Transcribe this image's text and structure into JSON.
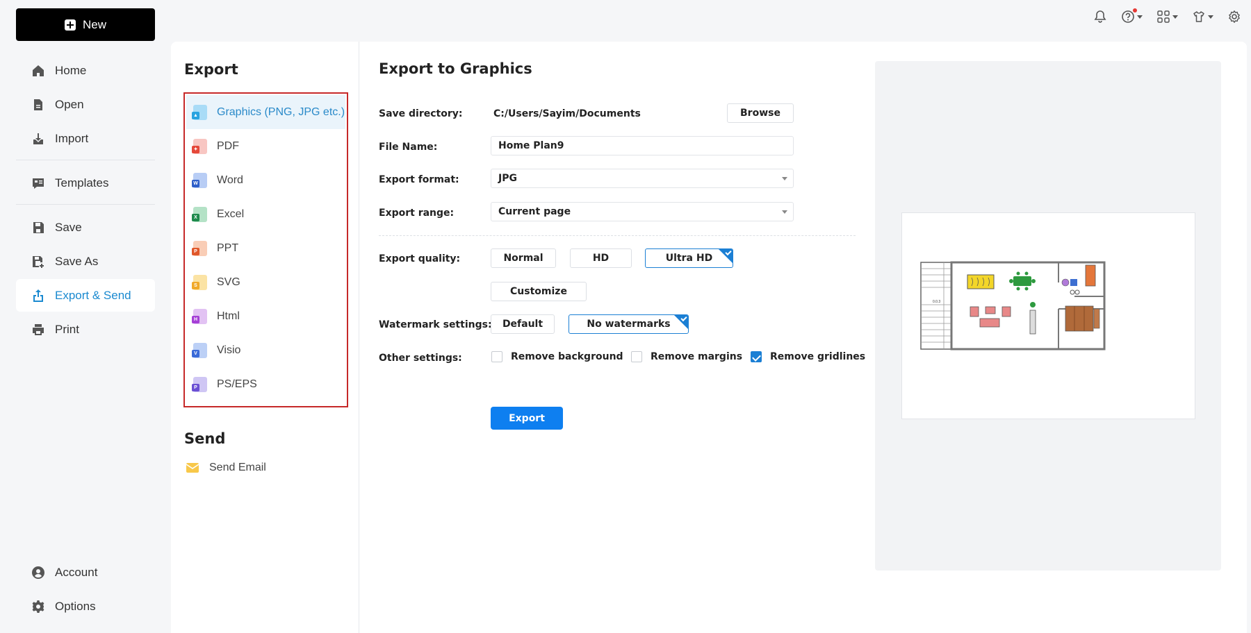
{
  "app": {
    "new_label": "New"
  },
  "topbar": {
    "icons": [
      "bell-icon",
      "help-icon",
      "apps-icon",
      "theme-icon",
      "settings-icon"
    ]
  },
  "nav": {
    "items": [
      {
        "label": "Home",
        "icon": "home-icon"
      },
      {
        "label": "Open",
        "icon": "open-icon"
      },
      {
        "label": "Import",
        "icon": "import-icon"
      },
      {
        "label": "Templates",
        "icon": "templates-icon"
      },
      {
        "label": "Save",
        "icon": "save-icon"
      },
      {
        "label": "Save As",
        "icon": "save-as-icon"
      },
      {
        "label": "Export & Send",
        "icon": "export-icon",
        "active": true
      },
      {
        "label": "Print",
        "icon": "print-icon"
      }
    ],
    "bottom": [
      {
        "label": "Account",
        "icon": "account-icon"
      },
      {
        "label": "Options",
        "icon": "options-icon"
      }
    ]
  },
  "export_section": {
    "title": "Export",
    "items": [
      {
        "label": "Graphics (PNG, JPG etc.)",
        "icon": "graphics-file-icon",
        "active": true
      },
      {
        "label": "PDF",
        "icon": "pdf-file-icon"
      },
      {
        "label": "Word",
        "icon": "word-file-icon"
      },
      {
        "label": "Excel",
        "icon": "excel-file-icon"
      },
      {
        "label": "PPT",
        "icon": "ppt-file-icon"
      },
      {
        "label": "SVG",
        "icon": "svg-file-icon"
      },
      {
        "label": "Html",
        "icon": "html-file-icon"
      },
      {
        "label": "Visio",
        "icon": "visio-file-icon"
      },
      {
        "label": "PS/EPS",
        "icon": "ps-eps-file-icon"
      }
    ]
  },
  "send_section": {
    "title": "Send",
    "items": [
      {
        "label": "Send Email",
        "icon": "email-icon"
      }
    ]
  },
  "form": {
    "title": "Export to Graphics",
    "save_directory_label": "Save directory:",
    "save_directory_value": "C:/Users/Sayim/Documents",
    "browse_label": "Browse",
    "file_name_label": "File Name:",
    "file_name_value": "Home Plan9",
    "export_format_label": "Export format:",
    "export_format_value": "JPG",
    "export_range_label": "Export range:",
    "export_range_value": "Current page",
    "export_quality_label": "Export quality:",
    "quality_options": [
      "Normal",
      "HD",
      "Ultra HD"
    ],
    "quality_selected": "Ultra HD",
    "customize_label": "Customize",
    "watermark_label": "Watermark settings:",
    "watermark_options": [
      "Default",
      "No watermarks"
    ],
    "watermark_selected": "No watermarks",
    "other_settings_label": "Other settings:",
    "remove_background_label": "Remove background",
    "remove_background_checked": false,
    "remove_margins_label": "Remove margins",
    "remove_margins_checked": false,
    "remove_gridlines_label": "Remove gridlines",
    "remove_gridlines_checked": true,
    "export_button_label": "Export"
  },
  "preview": {
    "stair_label": "0.0.3"
  },
  "colors": {
    "accent": "#1b7fd4",
    "export_button": "#0e7ff0",
    "highlight_border": "#c62828",
    "nav_active": "#1b8ad0"
  }
}
